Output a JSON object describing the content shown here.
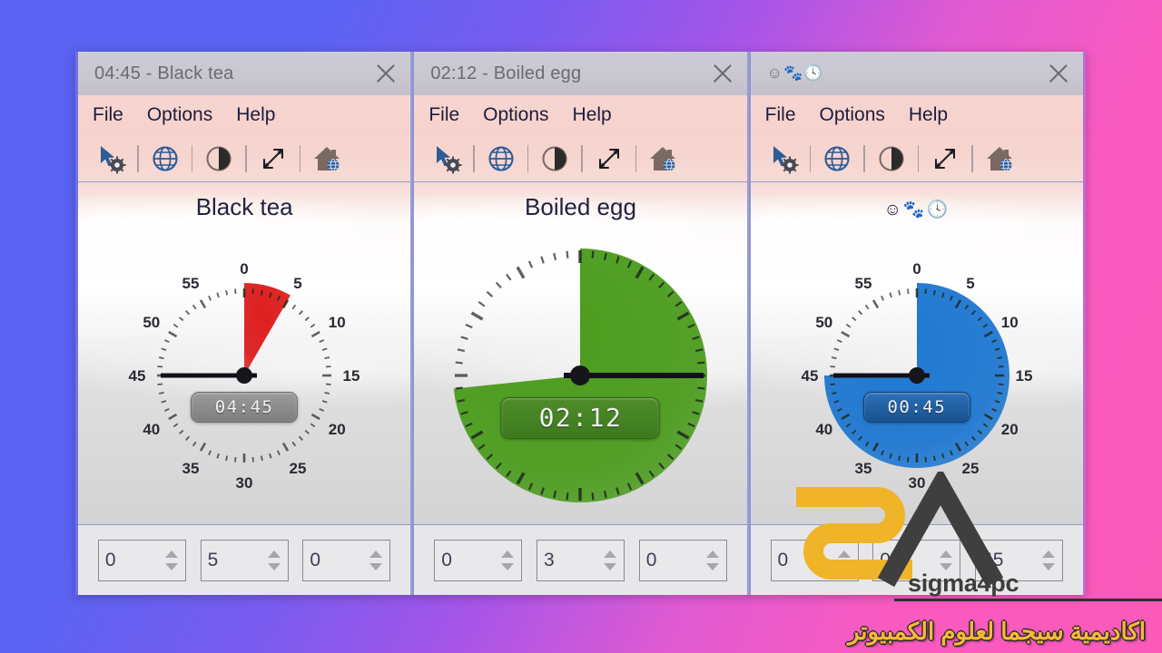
{
  "desktop": {
    "gradient_start": "#5a63f2",
    "gradient_end": "#fb5ab8"
  },
  "watermark": {
    "brand_text": "sigma4pc",
    "arabic_text": "اكاديمية سيجما لعلوم الكمبيوتر",
    "logo_yellow": "#f0b429",
    "logo_dark": "#3f3f3f"
  },
  "menu": {
    "file": "File",
    "options": "Options",
    "help": "Help"
  },
  "toolbar": {
    "icons": [
      {
        "name": "cursor-settings-icon",
        "label": "Settings"
      },
      {
        "name": "globe-icon",
        "label": "Language"
      },
      {
        "name": "contrast-icon",
        "label": "Contrast"
      },
      {
        "name": "resize-icon",
        "label": "Resize"
      },
      {
        "name": "home-globe-icon",
        "label": "Homepage"
      }
    ]
  },
  "windows": [
    {
      "title": "04:45 - Black tea",
      "heading": "Black tea",
      "close_label": "×",
      "clock": {
        "digital": "04:45",
        "accent": "#dd1f1f",
        "pie_start_min": 0,
        "pie_end_min": 5,
        "hand_min": 45,
        "dial_labels": [
          "0",
          "5",
          "10",
          "15",
          "20",
          "25",
          "30",
          "35",
          "40",
          "45",
          "50",
          "55"
        ],
        "style": "light"
      },
      "spinners": [
        {
          "name": "hours-spinner",
          "value": "0"
        },
        {
          "name": "minutes-spinner",
          "value": "5"
        },
        {
          "name": "seconds-spinner",
          "value": "0"
        }
      ]
    },
    {
      "title": "02:12 - Boiled egg",
      "heading": "Boiled egg",
      "close_label": "×",
      "clock": {
        "digital": "02:12",
        "accent": "#4c9c1e",
        "pie_start_min": 0,
        "pie_end_min": 44,
        "hand_min": 15,
        "dial_labels": [],
        "style": "green-large"
      },
      "spinners": [
        {
          "name": "hours-spinner",
          "value": "0"
        },
        {
          "name": "minutes-spinner",
          "value": "3"
        },
        {
          "name": "seconds-spinner",
          "value": "0"
        }
      ]
    },
    {
      "title": "☺🐾🕓",
      "heading": "☺🐾🕓",
      "title_is_emoji": true,
      "close_label": "×",
      "clock": {
        "digital": "00:45",
        "accent": "#1f78d1",
        "pie_start_min": 0,
        "pie_end_min": 45,
        "hand_min": 45,
        "dial_labels": [
          "0",
          "5",
          "10",
          "15",
          "20",
          "25",
          "30",
          "35",
          "40",
          "45",
          "50",
          "55"
        ],
        "style": "blue"
      },
      "spinners": [
        {
          "name": "hours-spinner",
          "value": "0"
        },
        {
          "name": "minutes-spinner",
          "value": "0"
        },
        {
          "name": "seconds-spinner",
          "value": "45"
        }
      ]
    }
  ]
}
